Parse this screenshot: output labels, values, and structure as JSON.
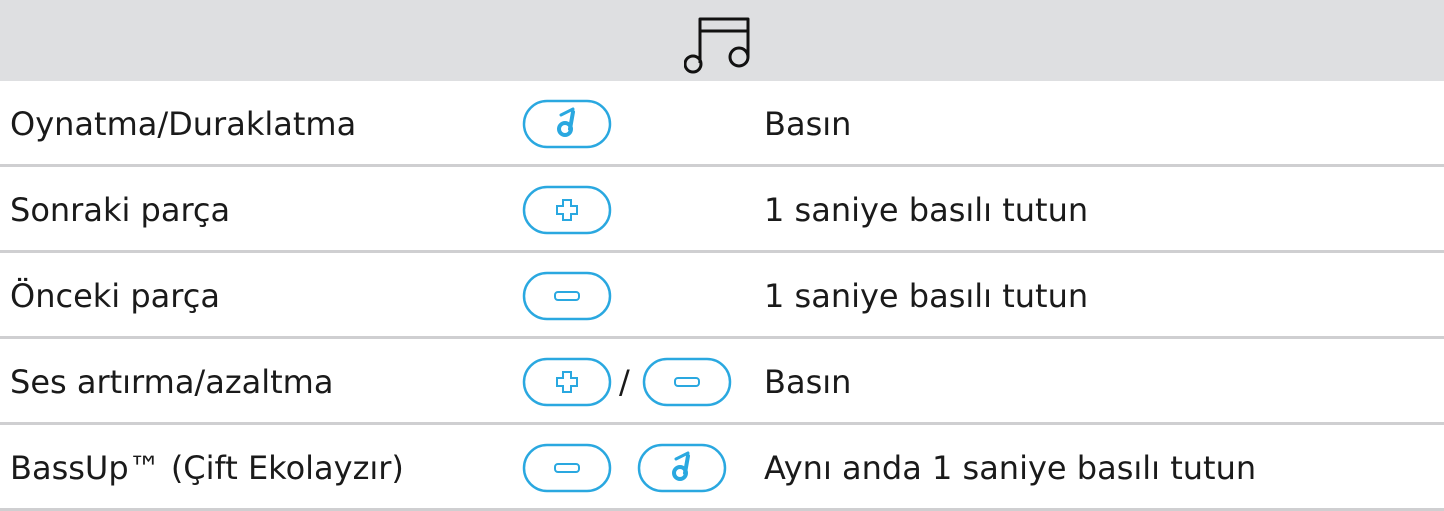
{
  "header": {
    "icon": "music-note-icon"
  },
  "accent_color": "#2aa8e0",
  "rows": [
    {
      "label": "Oynatma/Duraklatma",
      "buttons": [
        "play-pause-button-icon"
      ],
      "action": "Basın"
    },
    {
      "label": "Sonraki parça",
      "buttons": [
        "plus-button-icon"
      ],
      "action": "1 saniye basılı tutun"
    },
    {
      "label": "Önceki parça",
      "buttons": [
        "minus-button-icon"
      ],
      "action": "1 saniye basılı tutun"
    },
    {
      "label": "Ses artırma/azaltma",
      "buttons": [
        "plus-button-icon",
        "minus-button-icon"
      ],
      "separator": "/",
      "action": "Basın"
    },
    {
      "label": "BassUp™ (Çift Ekolayzır)",
      "buttons": [
        "minus-button-icon",
        "play-pause-button-icon"
      ],
      "action": "Aynı anda 1 saniye basılı tutun"
    }
  ]
}
